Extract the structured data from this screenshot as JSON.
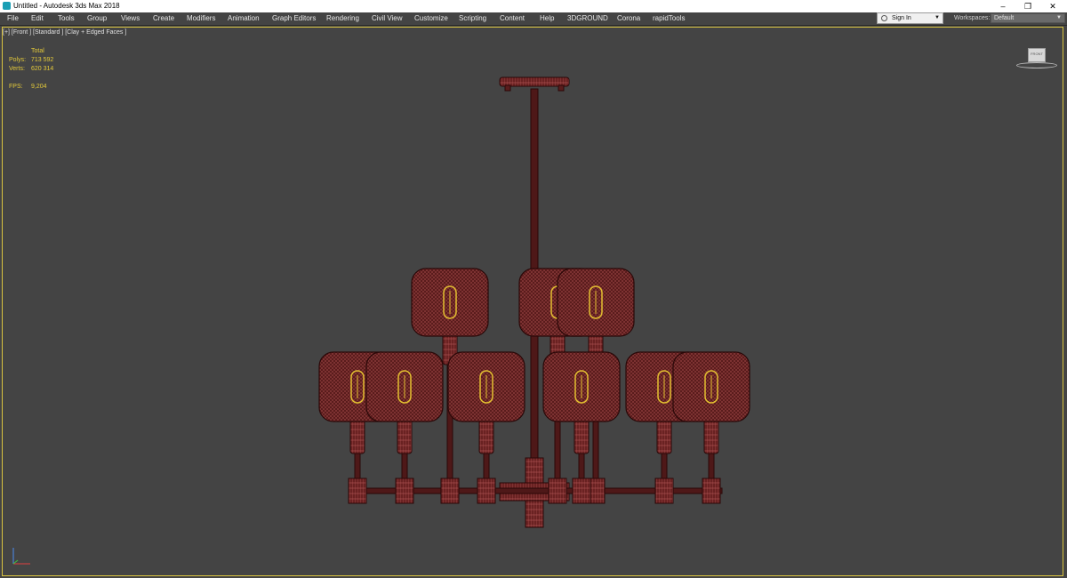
{
  "window": {
    "title": "Untitled - Autodesk 3ds Max 2018",
    "controls": {
      "minimize": "–",
      "restore": "❐",
      "close": "✕"
    }
  },
  "menu": {
    "items": [
      "File",
      "Edit",
      "Tools",
      "Group",
      "Views",
      "Create",
      "Modifiers",
      "Animation",
      "Graph Editors",
      "Rendering",
      "Civil View",
      "Customize",
      "Scripting",
      "Content",
      "Help",
      "3DGROUND",
      "Corona",
      "rapidTools"
    ]
  },
  "account": {
    "sign_in": "Sign In"
  },
  "workspaces": {
    "label": "Workspaces:",
    "value": "Default"
  },
  "viewport": {
    "label": "[+] [Front ] [Standard ] [Clay + Edged Faces ]",
    "stats": {
      "header": "Total",
      "polys_label": "Polys:",
      "polys_value": "713 592",
      "verts_label": "Verts:",
      "verts_value": "620 314",
      "fps_label": "FPS:",
      "fps_value": "9,204"
    },
    "colors": {
      "background": "#444444",
      "border": "#d9c440",
      "mesh_fill": "#5e1e1e",
      "mesh_wire": "#b05a5a",
      "bulb": "#e3c030"
    }
  }
}
